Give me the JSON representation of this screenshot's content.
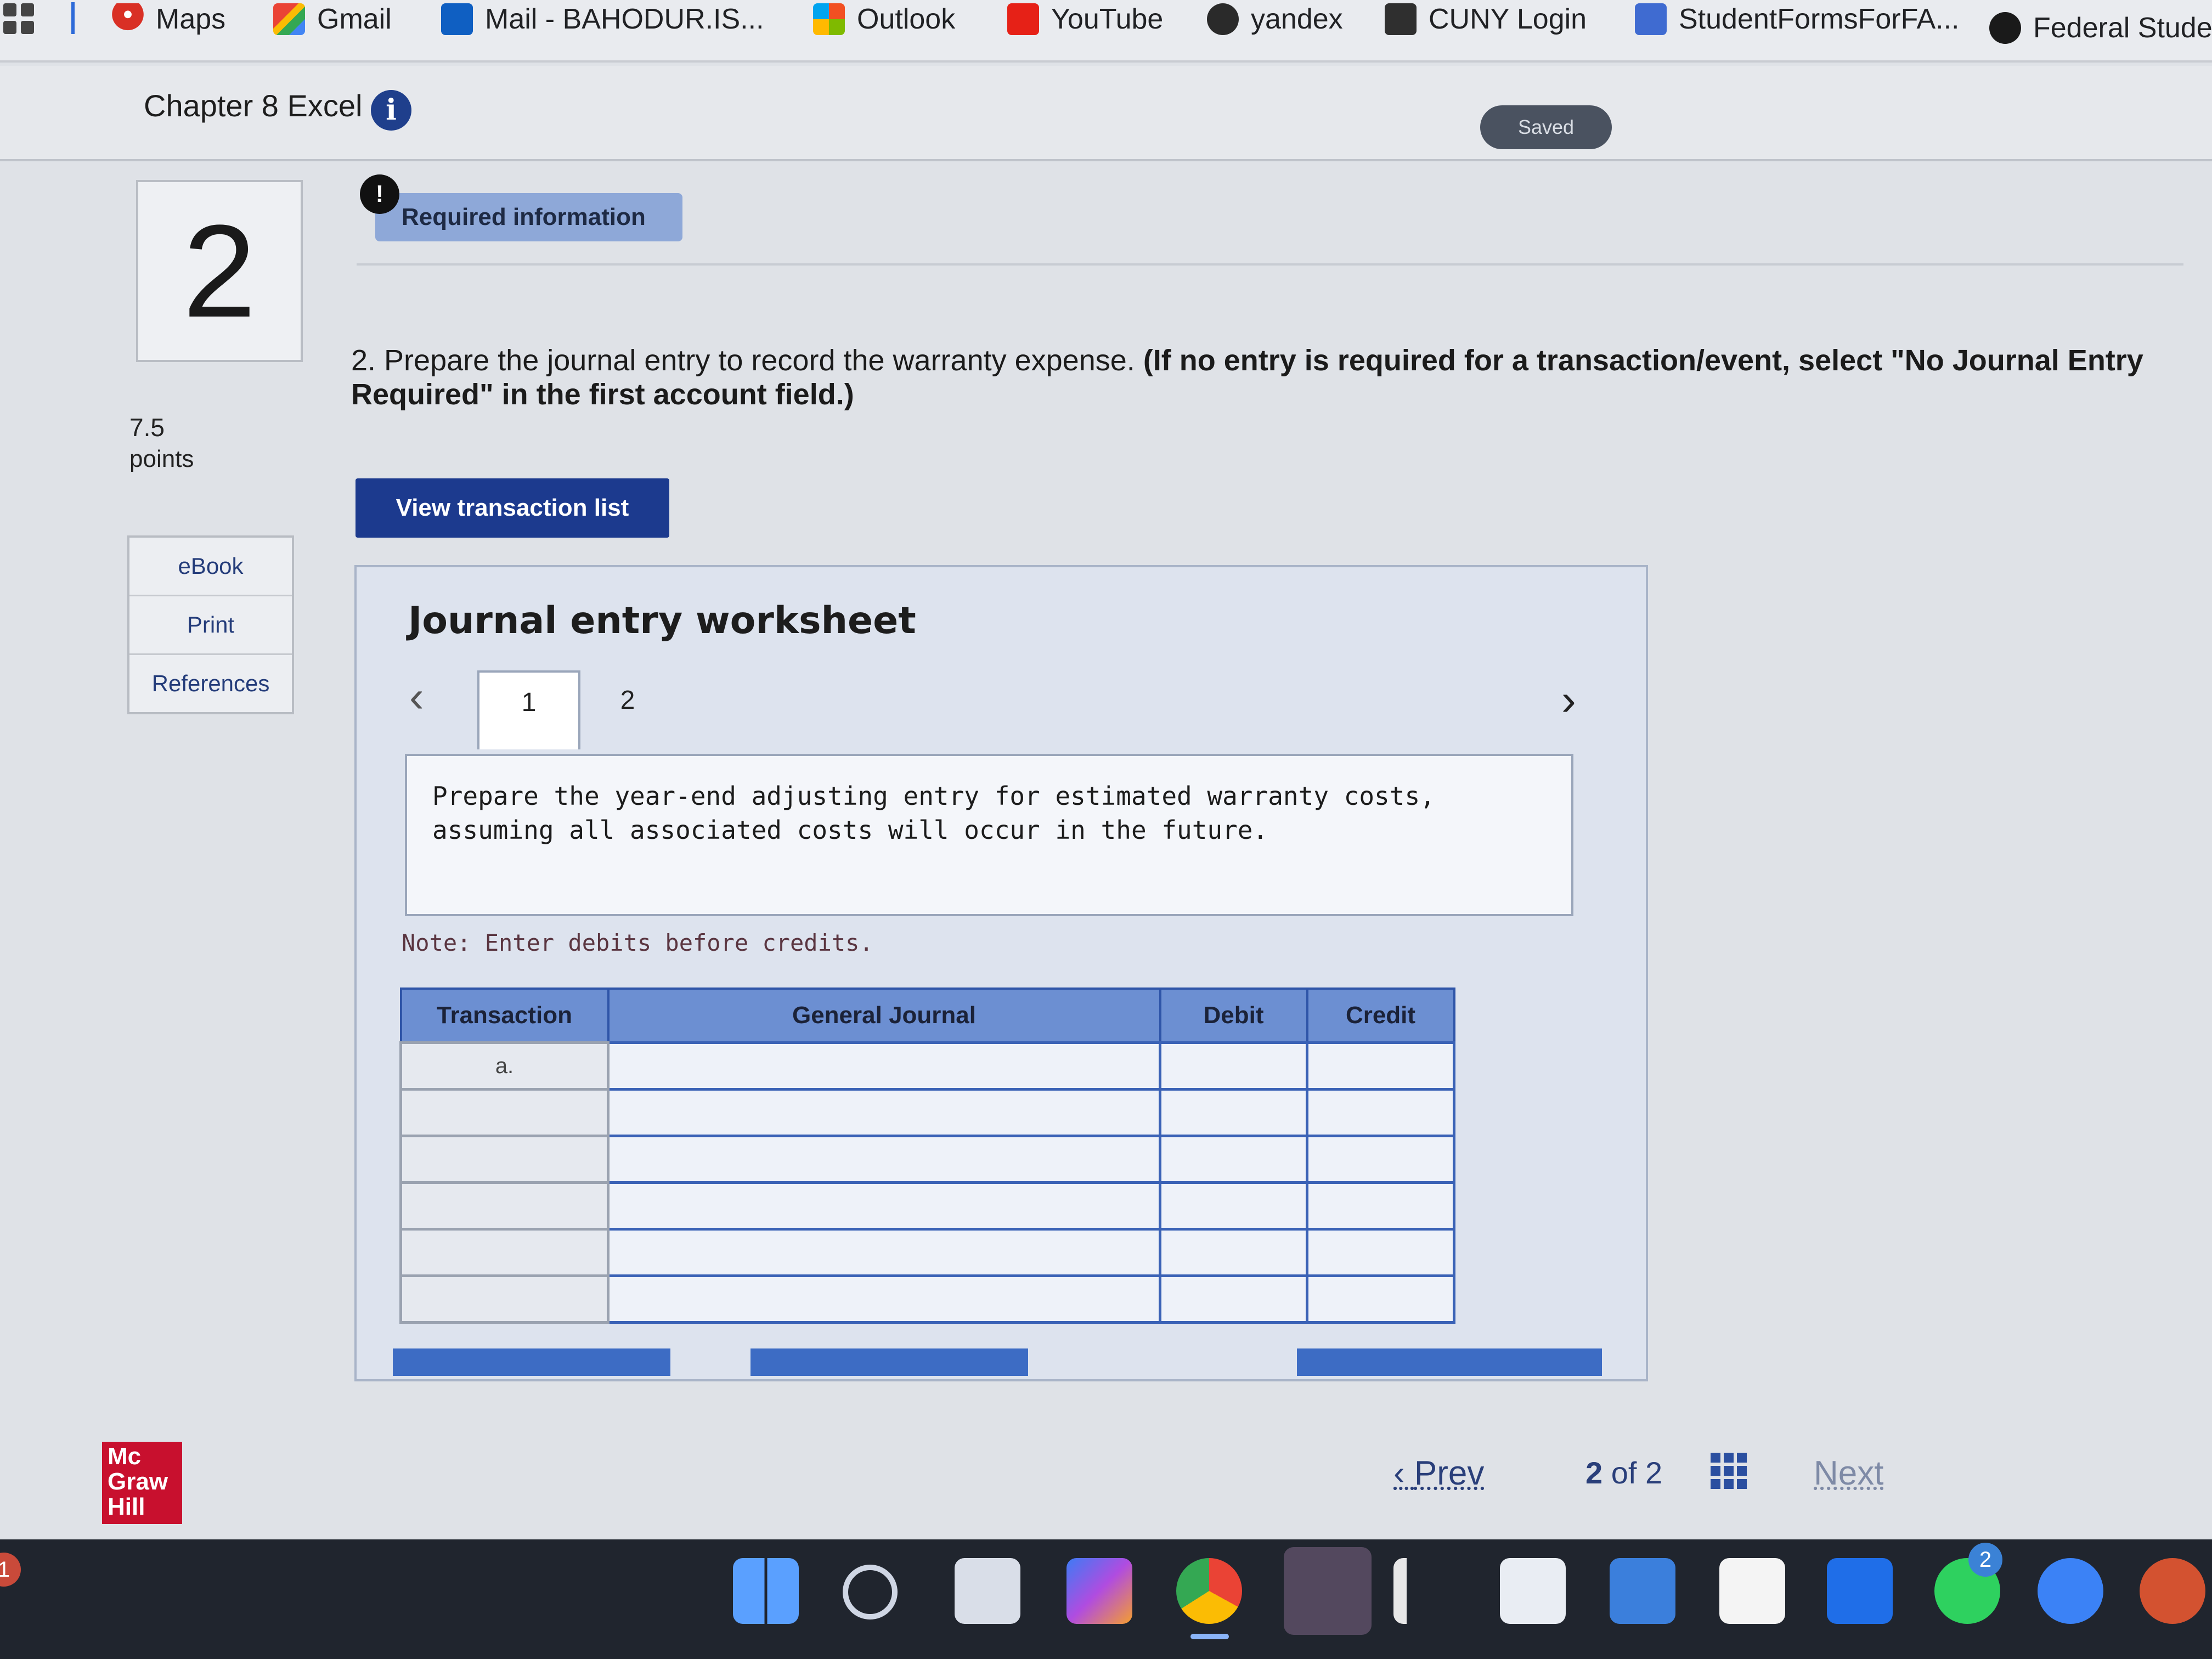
{
  "bookmarks": [
    {
      "label": "Maps",
      "icon": "map-pin-icon"
    },
    {
      "label": "Gmail",
      "icon": "gmail-icon"
    },
    {
      "label": "Mail - BAHODUR.IS...",
      "icon": "outlook-mail-icon"
    },
    {
      "label": "Outlook",
      "icon": "windows-grid-icon"
    },
    {
      "label": "YouTube",
      "icon": "youtube-icon"
    },
    {
      "label": "yandex",
      "icon": "yandex-icon"
    },
    {
      "label": "CUNY Login",
      "icon": "cuny-icon"
    },
    {
      "label": "StudentFormsForFA...",
      "icon": "document-icon"
    },
    {
      "label": "Federal Studen",
      "icon": "federal-seal-icon"
    }
  ],
  "header": {
    "assignment_title": "Chapter 8 Excel",
    "status": "Saved"
  },
  "question": {
    "number": "2",
    "points_value": "7.5",
    "points_label": "points",
    "resources": [
      "eBook",
      "Print",
      "References"
    ],
    "required_info_label": "Required information",
    "prompt_plain": "2. Prepare the journal entry to record the warranty expense.",
    "prompt_bold": "(If no entry is required for a transaction/event, select \"No Journal Entry Required\" in the first account field.)",
    "view_button_label": "View transaction list"
  },
  "worksheet": {
    "title": "Journal entry worksheet",
    "tabs": [
      "1",
      "2"
    ],
    "active_tab": "1",
    "instruction": "Prepare the year-end adjusting entry for estimated warranty costs, assuming all associated costs will occur in the future.",
    "note": "Note: Enter debits before credits.",
    "table": {
      "headers": [
        "Transaction",
        "General Journal",
        "Debit",
        "Credit"
      ],
      "rows": [
        {
          "transaction": "a.",
          "account": "",
          "debit": "",
          "credit": ""
        },
        {
          "transaction": "",
          "account": "",
          "debit": "",
          "credit": ""
        },
        {
          "transaction": "",
          "account": "",
          "debit": "",
          "credit": ""
        },
        {
          "transaction": "",
          "account": "",
          "debit": "",
          "credit": ""
        },
        {
          "transaction": "",
          "account": "",
          "debit": "",
          "credit": ""
        },
        {
          "transaction": "",
          "account": "",
          "debit": "",
          "credit": ""
        }
      ]
    }
  },
  "footer": {
    "publisher_logo_text": "Mc Graw Hill",
    "prev_label": "Prev",
    "page_current": "2",
    "page_of": "of",
    "page_total": "2",
    "next_label": "Next"
  },
  "taskbar": {
    "apps": [
      "windows-start-icon",
      "search-icon",
      "task-view-icon",
      "copilot-icon",
      "chrome-icon",
      "edge-icon",
      "arrow-app-icon",
      "store-icon",
      "mail-icon",
      "amazon-icon",
      "dropbox-icon",
      "whatsapp-icon",
      "emoji-app-icon",
      "powerpoint-icon"
    ],
    "whatsapp_badge": "2",
    "left_badge": "1"
  },
  "colors": {
    "brand_blue": "#1c3a8e",
    "table_header": "#6c8fd2",
    "mcgraw_red": "#c8102e"
  }
}
